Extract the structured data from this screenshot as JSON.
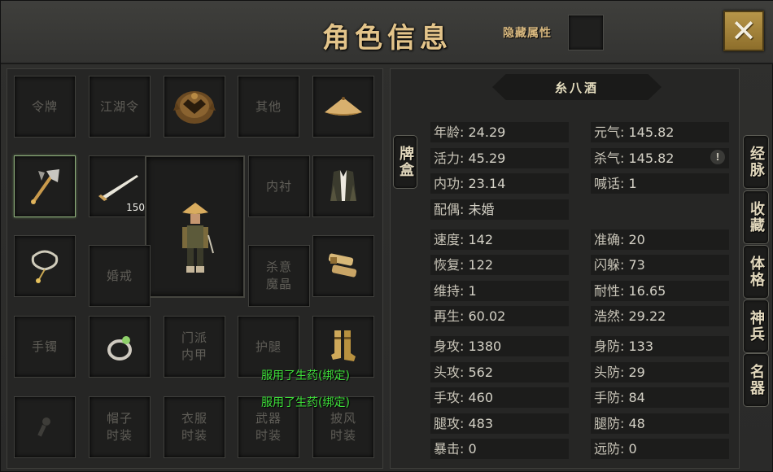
{
  "title": "角色信息",
  "hidden_attr_label": "隐藏属性",
  "close_symbol": "✕",
  "character_name": "糸八酒",
  "side_tab_left": "牌盒",
  "right_tabs": [
    "经脉",
    "收藏",
    "体格",
    "神兵",
    "名器"
  ],
  "slots": {
    "token": "令牌",
    "jianghu_token": "江湖令",
    "other": "其他",
    "inner_lining": "内衬",
    "wedding_ring": "婚戒",
    "killing_crystal": "杀意\n魔晶",
    "bracelet": "手镯",
    "sect_armor": "门派\n内甲",
    "leg_guard": "护腿",
    "hat_fashion": "帽子\n时装",
    "clothes_fashion": "衣服\n时装",
    "weapon_fashion": "武器\n时装",
    "cloak_fashion": "披风\n时装",
    "blade_count": "150"
  },
  "icons": {
    "helmet": "bronze-helmet-icon",
    "bamboo_hat": "bamboo-hat-icon",
    "axe": "axe-weapon-icon",
    "blade": "blade-weapon-icon",
    "vest": "vest-armor-icon",
    "necklace": "necklace-icon",
    "bracers": "bracers-icon",
    "ring": "jade-ring-icon",
    "boots": "boots-icon",
    "key": "key-icon"
  },
  "pickup_messages": [
    "服用了生药(绑定)",
    "服用了生药(绑定)"
  ],
  "stats_left": [
    {
      "label": "年龄:",
      "value": "24.29"
    },
    {
      "label": "活力:",
      "value": "45.29"
    },
    {
      "label": "内功:",
      "value": "23.14"
    },
    {
      "label": "配偶:",
      "value": "未婚"
    },
    {
      "label": "速度:",
      "value": "142"
    },
    {
      "label": "恢复:",
      "value": "122"
    },
    {
      "label": "维持:",
      "value": "1"
    },
    {
      "label": "再生:",
      "value": "60.02"
    },
    {
      "label": "身攻:",
      "value": "1380"
    },
    {
      "label": "头攻:",
      "value": "562"
    },
    {
      "label": "手攻:",
      "value": "460"
    },
    {
      "label": "腿攻:",
      "value": "483"
    },
    {
      "label": "暴击:",
      "value": "0"
    }
  ],
  "stats_right": [
    {
      "label": "元气:",
      "value": "145.82"
    },
    {
      "label": "杀气:",
      "value": "145.82"
    },
    {
      "label": "喊话:",
      "value": "1"
    },
    {
      "label": "准确:",
      "value": "20"
    },
    {
      "label": "闪躲:",
      "value": "73"
    },
    {
      "label": "耐性:",
      "value": "16.65"
    },
    {
      "label": "浩然:",
      "value": "29.22"
    },
    {
      "label": "身防:",
      "value": "133"
    },
    {
      "label": "头防:",
      "value": "29"
    },
    {
      "label": "手防:",
      "value": "84"
    },
    {
      "label": "腿防:",
      "value": "48"
    },
    {
      "label": "远防:",
      "value": "0"
    }
  ],
  "warn_symbol": "!"
}
